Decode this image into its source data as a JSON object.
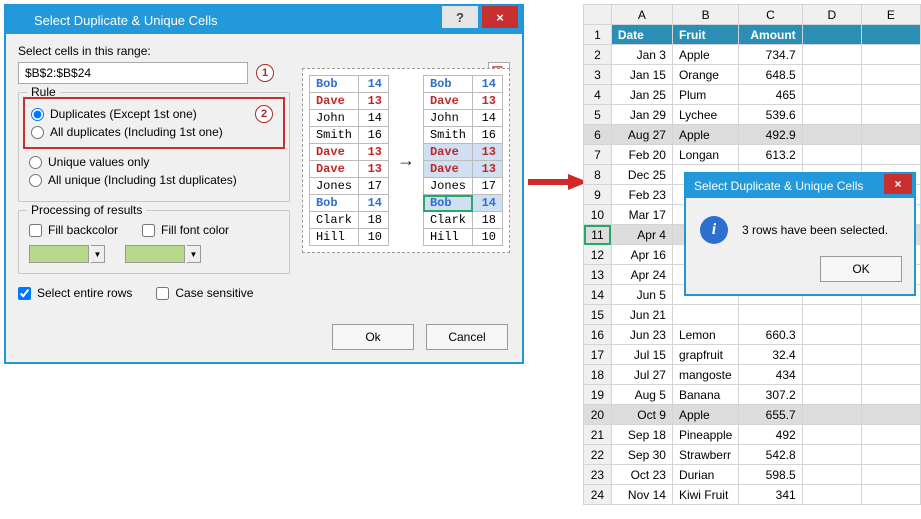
{
  "dialog1": {
    "title": "Select Duplicate & Unique Cells",
    "help": "?",
    "close": "×",
    "rangeLabel": "Select cells in this range:",
    "rangeValue": "$B$2:$B$24",
    "callout1": "1",
    "callout2": "2",
    "ruleTitle": "Rule",
    "opt1": "Duplicates (Except 1st one)",
    "opt2": "All duplicates (Including 1st one)",
    "opt3": "Unique values only",
    "opt4": "All unique (Including 1st duplicates)",
    "procTitle": "Processing of results",
    "fillBack": "Fill backcolor",
    "fillFont": "Fill font color",
    "selectRows": "Select entire rows",
    "caseSens": "Case sensitive",
    "ok": "Ok",
    "cancel": "Cancel",
    "arrow": "→"
  },
  "preview": {
    "left": [
      {
        "n": "Bob",
        "v": "14",
        "c": "blue"
      },
      {
        "n": "Dave",
        "v": "13",
        "c": "redb"
      },
      {
        "n": "John",
        "v": "14",
        "c": ""
      },
      {
        "n": "Smith",
        "v": "16",
        "c": ""
      },
      {
        "n": "Dave",
        "v": "13",
        "c": "redb"
      },
      {
        "n": "Dave",
        "v": "13",
        "c": "redb"
      },
      {
        "n": "Jones",
        "v": "17",
        "c": ""
      },
      {
        "n": "Bob",
        "v": "14",
        "c": "blue"
      },
      {
        "n": "Clark",
        "v": "18",
        "c": ""
      },
      {
        "n": "Hill",
        "v": "10",
        "c": ""
      }
    ],
    "right": [
      {
        "n": "Bob",
        "v": "14",
        "c": "blue",
        "hl": false,
        "sel": false
      },
      {
        "n": "Dave",
        "v": "13",
        "c": "redb",
        "hl": false,
        "sel": false
      },
      {
        "n": "John",
        "v": "14",
        "c": "",
        "hl": false,
        "sel": false
      },
      {
        "n": "Smith",
        "v": "16",
        "c": "",
        "hl": false,
        "sel": false
      },
      {
        "n": "Dave",
        "v": "13",
        "c": "redb",
        "hl": true,
        "sel": false
      },
      {
        "n": "Dave",
        "v": "13",
        "c": "redb",
        "hl": true,
        "sel": false
      },
      {
        "n": "Jones",
        "v": "17",
        "c": "",
        "hl": false,
        "sel": false
      },
      {
        "n": "Bob",
        "v": "14",
        "c": "blue",
        "hl": true,
        "sel": true
      },
      {
        "n": "Clark",
        "v": "18",
        "c": "",
        "hl": false,
        "sel": false
      },
      {
        "n": "Hill",
        "v": "10",
        "c": "",
        "hl": false,
        "sel": false
      }
    ]
  },
  "sheet": {
    "cols": [
      "A",
      "B",
      "C",
      "D",
      "E"
    ],
    "header": [
      "Date",
      "Fruit",
      "Amount"
    ],
    "rows": [
      {
        "r": 2,
        "a": "Jan 3",
        "b": "Apple",
        "c": "734.7"
      },
      {
        "r": 3,
        "a": "Jan 15",
        "b": "Orange",
        "c": "648.5"
      },
      {
        "r": 4,
        "a": "Jan 25",
        "b": "Plum",
        "c": "465"
      },
      {
        "r": 5,
        "a": "Jan 29",
        "b": "Lychee",
        "c": "539.6"
      },
      {
        "r": 6,
        "a": "Aug 27",
        "b": "Apple",
        "c": "492.9",
        "sel": true
      },
      {
        "r": 7,
        "a": "Feb 20",
        "b": "Longan",
        "c": "613.2"
      },
      {
        "r": 8,
        "a": "Dec 25",
        "b": "",
        "c": ""
      },
      {
        "r": 9,
        "a": "Feb 23",
        "b": "",
        "c": ""
      },
      {
        "r": 10,
        "a": "Mar 17",
        "b": "",
        "c": ""
      },
      {
        "r": 11,
        "a": "Apr 4",
        "b": "",
        "c": "",
        "sel": true,
        "active": true
      },
      {
        "r": 12,
        "a": "Apr 16",
        "b": "",
        "c": ""
      },
      {
        "r": 13,
        "a": "Apr 24",
        "b": "",
        "c": ""
      },
      {
        "r": 14,
        "a": "Jun 5",
        "b": "",
        "c": ""
      },
      {
        "r": 15,
        "a": "Jun 21",
        "b": "",
        "c": ""
      },
      {
        "r": 16,
        "a": "Jun 23",
        "b": "Lemon",
        "c": "660.3"
      },
      {
        "r": 17,
        "a": "Jul 15",
        "b": "grapfruit",
        "c": "32.4"
      },
      {
        "r": 18,
        "a": "Jul 27",
        "b": "mangoste",
        "c": "434"
      },
      {
        "r": 19,
        "a": "Aug 5",
        "b": "Banana",
        "c": "307.2"
      },
      {
        "r": 20,
        "a": "Oct 9",
        "b": "Apple",
        "c": "655.7",
        "sel": true
      },
      {
        "r": 21,
        "a": "Sep 18",
        "b": "Pineapple",
        "c": "492"
      },
      {
        "r": 22,
        "a": "Sep 30",
        "b": "Strawberr",
        "c": "542.8"
      },
      {
        "r": 23,
        "a": "Oct 23",
        "b": "Durian",
        "c": "598.5"
      },
      {
        "r": 24,
        "a": "Nov 14",
        "b": "Kiwi Fruit",
        "c": "341"
      }
    ]
  },
  "dialog2": {
    "title": "Select Duplicate & Unique Cells",
    "close": "×",
    "msg": "3 rows have been selected.",
    "info": "i",
    "ok": "OK"
  }
}
